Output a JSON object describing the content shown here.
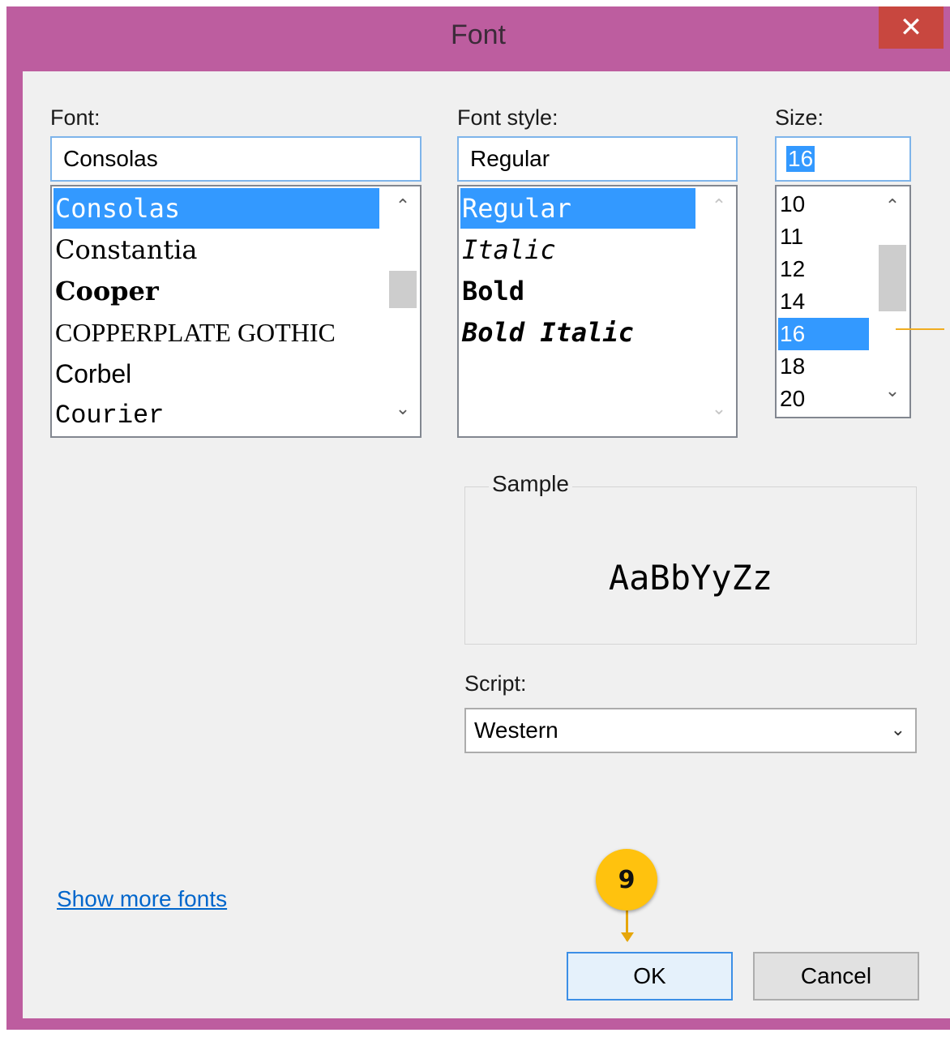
{
  "window": {
    "title": "Font",
    "close_glyph": "✕"
  },
  "font": {
    "label": "Font:",
    "value": "Consolas",
    "items": [
      {
        "text": "Consolas",
        "family": "\"DejaVu Sans Mono\", monospace",
        "style": "normal",
        "weight": "normal"
      },
      {
        "text": "Constantia",
        "family": "\"DejaVu Serif\", serif",
        "style": "normal",
        "weight": "normal"
      },
      {
        "text": "Cooper",
        "family": "\"DejaVu Serif\", serif",
        "style": "normal",
        "weight": "bold"
      },
      {
        "text": "COPPERPLATE GOTHIC",
        "family": "\"Liberation Serif\", serif",
        "style": "normal",
        "weight": "normal"
      },
      {
        "text": "Corbel",
        "family": "\"Liberation Sans\", sans-serif",
        "style": "normal",
        "weight": "normal"
      },
      {
        "text": "Courier",
        "family": "\"Liberation Mono\", monospace",
        "style": "normal",
        "weight": "normal"
      }
    ],
    "selected_index": 0
  },
  "style": {
    "label": "Font style:",
    "value": "Regular",
    "items": [
      {
        "text": "Regular",
        "style": "normal",
        "weight": "normal"
      },
      {
        "text": "Italic",
        "style": "italic",
        "weight": "normal"
      },
      {
        "text": "Bold",
        "style": "normal",
        "weight": "bold"
      },
      {
        "text": "Bold Italic",
        "style": "italic",
        "weight": "bold"
      }
    ],
    "selected_index": 0
  },
  "size": {
    "label": "Size:",
    "value": "16",
    "items": [
      "10",
      "11",
      "12",
      "14",
      "16",
      "18",
      "20"
    ],
    "selected_index": 4
  },
  "sample": {
    "legend": "Sample",
    "text": "AaBbYyZz"
  },
  "script": {
    "label": "Script:",
    "value": "Western"
  },
  "links": {
    "show_more": "Show more fonts"
  },
  "buttons": {
    "ok": "OK",
    "cancel": "Cancel"
  },
  "callout": {
    "number": "9"
  },
  "icons": {
    "scroll_up": "chevron-up-icon",
    "scroll_down": "chevron-down-icon",
    "dropdown": "chevron-down-icon",
    "close": "close-icon"
  },
  "colors": {
    "titlebar": "#bd5d9f",
    "close": "#c8473f",
    "selection": "#3399ff",
    "callout": "#ffc20e",
    "link": "#0066cc"
  }
}
